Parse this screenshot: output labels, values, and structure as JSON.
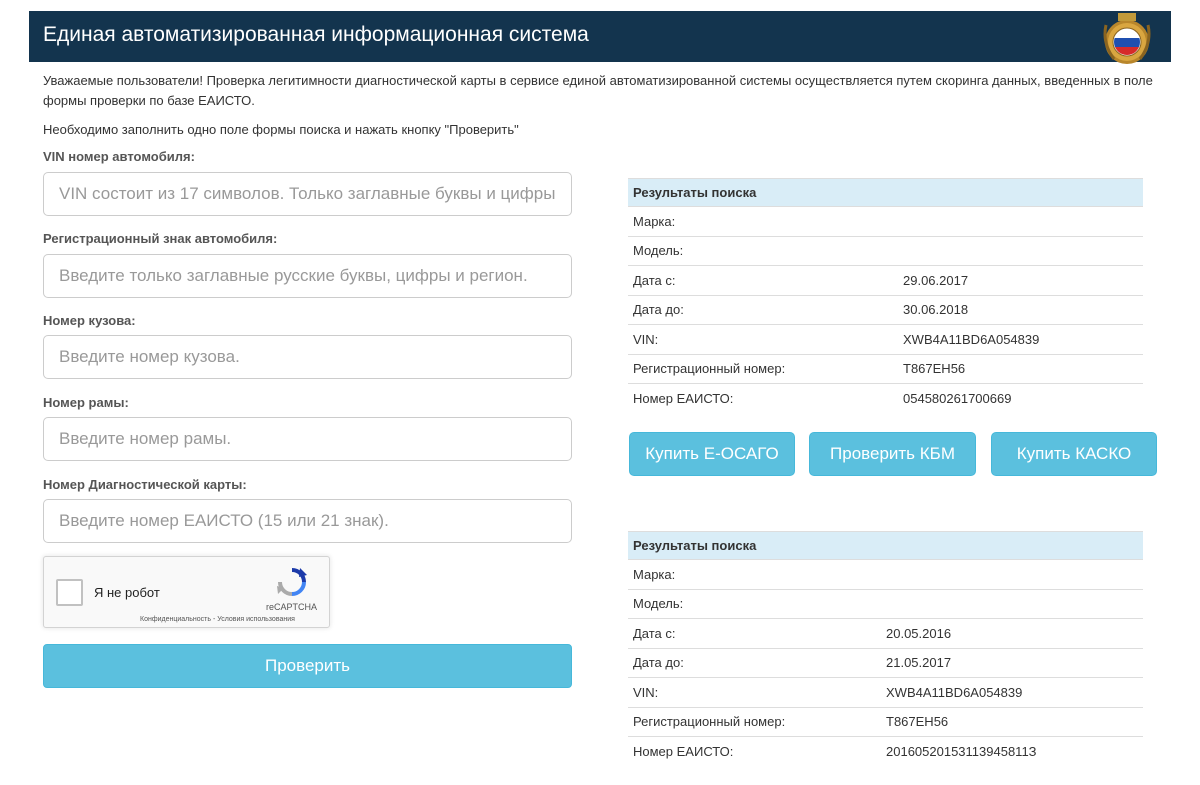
{
  "header": {
    "title": "Единая автоматизированная информационная система"
  },
  "intro": {
    "line1": "Уважаемые пользователи! Проверка легитимности диагностической карты в сервисе единой автоматизированной системы осуществляется путем скоринга данных, введенных в поле формы проверки по базе ЕАИСТО.",
    "line2": "Необходимо заполнить одно поле формы поиска и нажать кнопку \"Проверить\""
  },
  "form": {
    "vin": {
      "label": "VIN номер автомобиля:",
      "placeholder": "VIN состоит из 17 символов. Только заглавные буквы и цифры"
    },
    "reg": {
      "label": "Регистрационный знак автомобиля:",
      "placeholder": "Введите только заглавные русские буквы, цифры и регион."
    },
    "body": {
      "label": "Номер кузова:",
      "placeholder": "Введите номер кузова."
    },
    "frame": {
      "label": "Номер рамы:",
      "placeholder": "Введите номер рамы."
    },
    "card": {
      "label": "Номер Диагностической карты:",
      "placeholder": "Введите номер ЕАИСТО (15 или 21 знак)."
    },
    "captcha": {
      "label": "Я не робот",
      "brand": "reCAPTCHA",
      "links": "Конфиденциальность - Условия использования"
    },
    "submit": "Проверить"
  },
  "results": [
    {
      "title": "Результаты поиска",
      "rows": [
        {
          "label": "Марка:",
          "value": ""
        },
        {
          "label": "Модель:",
          "value": ""
        },
        {
          "label": "Дата с:",
          "value": "29.06.2017"
        },
        {
          "label": "Дата до:",
          "value": "30.06.2018"
        },
        {
          "label": "VIN:",
          "value": "XWB4A11BD6A054839"
        },
        {
          "label": "Регистрационный номер:",
          "value": "Т867ЕН56"
        },
        {
          "label": "Номер ЕАИСТО:",
          "value": "054580261700669"
        }
      ]
    },
    {
      "title": "Результаты поиска",
      "rows": [
        {
          "label": "Марка:",
          "value": ""
        },
        {
          "label": "Модель:",
          "value": ""
        },
        {
          "label": "Дата с:",
          "value": "20.05.2016"
        },
        {
          "label": "Дата до:",
          "value": "21.05.2017"
        },
        {
          "label": "VIN:",
          "value": "XWB4A11BD6A054839"
        },
        {
          "label": "Регистрационный номер:",
          "value": "Т867ЕН56"
        },
        {
          "label": "Номер ЕАИСТО:",
          "value": "20160520153113945811З"
        }
      ]
    }
  ],
  "actions": {
    "osago": "Купить Е-ОСАГО",
    "kbm": "Проверить КБМ",
    "kasko": "Купить КАСКО"
  },
  "colors": {
    "header_bg": "#13344e",
    "button": "#5bc0de",
    "table_head": "#d9edf7"
  },
  "icons": {
    "emblem": "russian-flag-emblem-icon",
    "captcha": "recaptcha-logo-icon"
  }
}
